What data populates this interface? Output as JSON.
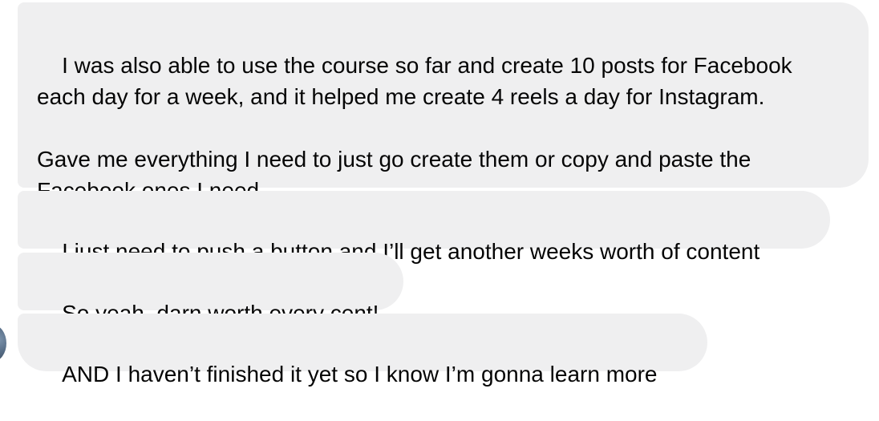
{
  "messages": [
    {
      "paragraphs": [
        "I was also able to use the course so far and create 10 posts for Facebook\neach day for a week, and it helped me create 4 reels a day for Instagram.",
        "Gave me everything I need to just go create them or copy and paste the\nFacebook ones I need"
      ]
    },
    {
      "text": "I just need to push a button and I’ll get another weeks worth of content"
    },
    {
      "text": "So yeah, darn worth every cent!"
    },
    {
      "text": "AND I haven’t finished it yet so I know I’m gonna learn more"
    }
  ],
  "sender": {
    "avatar_icon": "sender-avatar-photo"
  },
  "colors": {
    "bubble_background": "#efeff0",
    "text": "#050505"
  }
}
